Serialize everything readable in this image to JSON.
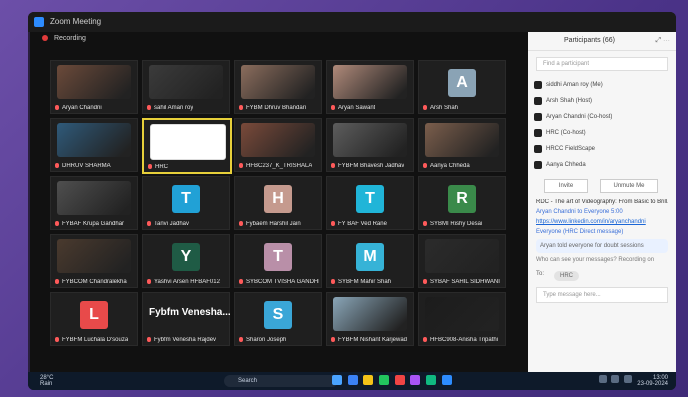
{
  "window": {
    "title": "Zoom Meeting",
    "recording_label": "Recording"
  },
  "grid": {
    "tiles": [
      {
        "name": "Aryan Chandni",
        "type": "video",
        "bg": "#6b4a3a"
      },
      {
        "name": "sahil Aman roy",
        "type": "video",
        "bg": "#3b3b3b"
      },
      {
        "name": "FYBM Dhruv Bhandari",
        "type": "video",
        "bg": "#8b6d5d"
      },
      {
        "name": "Aryan Sawant",
        "type": "video",
        "bg": "#b08a7a"
      },
      {
        "name": "Arsh Shah",
        "type": "avatar",
        "letter": "A",
        "bg": "#8aa3b5"
      },
      {
        "name": "DHRUV SHARMA",
        "type": "video",
        "bg": "#2f5a7a"
      },
      {
        "name": "HRC",
        "type": "logo",
        "bg": "#ffffff",
        "active": true
      },
      {
        "name": "HFBC237_K_TRISHALA",
        "type": "video",
        "bg": "#7a4a3a"
      },
      {
        "name": "FYBFM Bhavesh Jadhav",
        "type": "video",
        "bg": "#5d5d5d"
      },
      {
        "name": "Aanya Chheda",
        "type": "video",
        "bg": "#7b5e4c"
      },
      {
        "name": "FYBAF Krupa Gandhar",
        "type": "video",
        "bg": "#4f4f4f"
      },
      {
        "name": "Tanvi Jadhav",
        "type": "avatar",
        "letter": "T",
        "bg": "#21a1d6"
      },
      {
        "name": "Fybaem Harshil Jain",
        "type": "avatar",
        "letter": "H",
        "bg": "#c59a8e"
      },
      {
        "name": "FY BAF Ved Rane",
        "type": "avatar",
        "letter": "T",
        "bg": "#20b5d8"
      },
      {
        "name": "SYBMI Rishy Desai",
        "type": "avatar",
        "letter": "R",
        "bg": "#3a8a4a"
      },
      {
        "name": "FYBCOM Chandralekha",
        "type": "video",
        "bg": "#4a3a2e"
      },
      {
        "name": "Yashvi Arsen HFBAF012",
        "type": "avatar",
        "letter": "Y",
        "bg": "#1f5b45"
      },
      {
        "name": "SYBCOM TVISHA GANDHI",
        "type": "avatar",
        "letter": "T",
        "bg": "#b98fa8"
      },
      {
        "name": "SYBFM Mahir Shah",
        "type": "avatar",
        "letter": "M",
        "bg": "#36b3d7"
      },
      {
        "name": "SYBAF SAHIL SIDHWANI",
        "type": "video",
        "bg": "#2b2b2b"
      },
      {
        "name": "FYBFM Luchala D'souza",
        "type": "avatar",
        "letter": "L",
        "bg": "#e84a4a"
      },
      {
        "name": "Fybfm Venesha Rajdev",
        "type": "text",
        "big": "Fybfm Venesha...",
        "bg": "#1f1f1f"
      },
      {
        "name": "Sharon Joseph",
        "type": "avatar",
        "letter": "S",
        "bg": "#3aa6d7"
      },
      {
        "name": "FYBFM Nishant Karjewad",
        "type": "video",
        "bg": "#8aa6b8"
      },
      {
        "name": "HFBC908-Anisha Tripathi",
        "type": "video",
        "bg": "#1c1c1c"
      }
    ]
  },
  "panel": {
    "title": "Participants (66)",
    "search_placeholder": "Find a participant",
    "participants": [
      {
        "name": "siddhi Aman roy (Me)"
      },
      {
        "name": "Arsh Shah (Host)"
      },
      {
        "name": "Aryan Chandni (Co-host)"
      },
      {
        "name": "HRC (Co-host)"
      },
      {
        "name": "HRCC FieldScape"
      },
      {
        "name": "Aanya Chheda"
      }
    ],
    "buttons": {
      "invite": "Invite",
      "unmute_all": "Unmute Me"
    },
    "chat_title": "RDC - The art of Videography: From Basic to Brill...",
    "chat_from": "Aryan Chandni to Everyone 5:00",
    "chat_link": "https://www.linkedin.com/in/aryanchandni",
    "chat_note": "Everyone (HRC Direct message)",
    "chat_bubble": "Aryan told everyone for doubt sessions",
    "who_can_see": "Who can see your messages? Recording on",
    "to_label": "To:",
    "to_chip": "HRC",
    "message_placeholder": "Type message here..."
  },
  "taskbar": {
    "weather_temp": "28°C",
    "weather_text": "Rain",
    "search_text": "Search",
    "time": "13:00",
    "date": "23-09-2024",
    "tray_lang": "ENG IN"
  }
}
